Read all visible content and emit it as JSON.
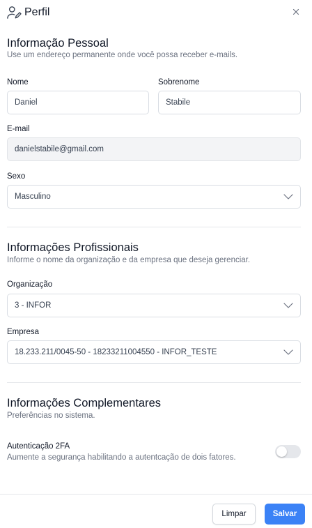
{
  "header": {
    "title": "Perfil",
    "user_icon": "user-edit-icon",
    "close_icon": "close-icon"
  },
  "personal": {
    "title": "Informação Pessoal",
    "subtitle": "Use um endereço permanente onde você possa receber e-mails.",
    "first_name": {
      "label": "Nome",
      "value": "Daniel"
    },
    "last_name": {
      "label": "Sobrenome",
      "value": "Stabile"
    },
    "email": {
      "label": "E-mail",
      "value": "danielstabile@gmail.com"
    },
    "sex": {
      "label": "Sexo",
      "value": "Masculino"
    }
  },
  "professional": {
    "title": "Informações Profissionais",
    "subtitle": "Informe o nome da organização e da empresa que deseja gerenciar.",
    "organization": {
      "label": "Organização",
      "value": "3 - INFOR"
    },
    "company": {
      "label": "Empresa",
      "value": "18.233.211/0045-50 - 18233211004550 - INFOR_TESTE"
    }
  },
  "complementary": {
    "title": "Informações Complementares",
    "subtitle": "Preferências no sistema.",
    "twofa": {
      "label": "Autenticação 2FA",
      "description": "Aumente a segurança habilitando a autentcação de dois fatores.",
      "enabled": false
    }
  },
  "footer": {
    "clear_label": "Limpar",
    "save_label": "Salvar"
  },
  "colors": {
    "primary": "#3b82f6",
    "border": "#d9dde3",
    "muted_text": "#6b7280",
    "disabled_bg": "#f3f4f6"
  }
}
